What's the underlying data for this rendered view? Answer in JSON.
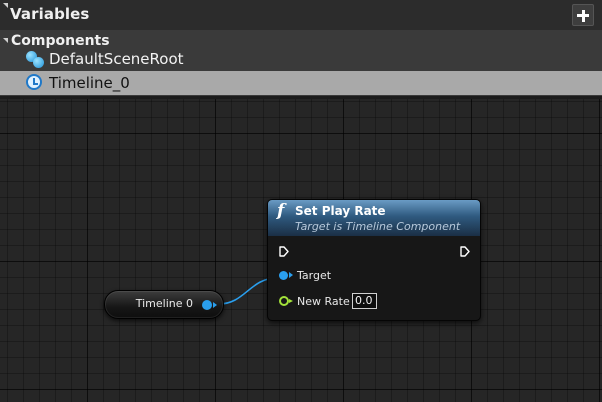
{
  "panel": {
    "variables_title": "Variables",
    "add_icon": "plus-icon",
    "components_title": "Components",
    "components": [
      {
        "label": "DefaultSceneRoot",
        "icon": "scene-root-icon",
        "selected": false
      },
      {
        "label": "Timeline_0",
        "icon": "timeline-clock-icon",
        "selected": true
      }
    ]
  },
  "graph": {
    "variable_node": {
      "label": "Timeline 0",
      "pin_color": "#2a9fee"
    },
    "function_node": {
      "icon": "function-f-icon",
      "title": "Set Play Rate",
      "subtitle": "Target is Timeline Component",
      "header_color": "#2f5a80",
      "pins": {
        "target_label": "Target",
        "new_rate_label": "New Rate",
        "new_rate_value": "0.0"
      },
      "target_pin_color": "#2a9fee",
      "float_pin_color": "#a3e23a"
    }
  }
}
